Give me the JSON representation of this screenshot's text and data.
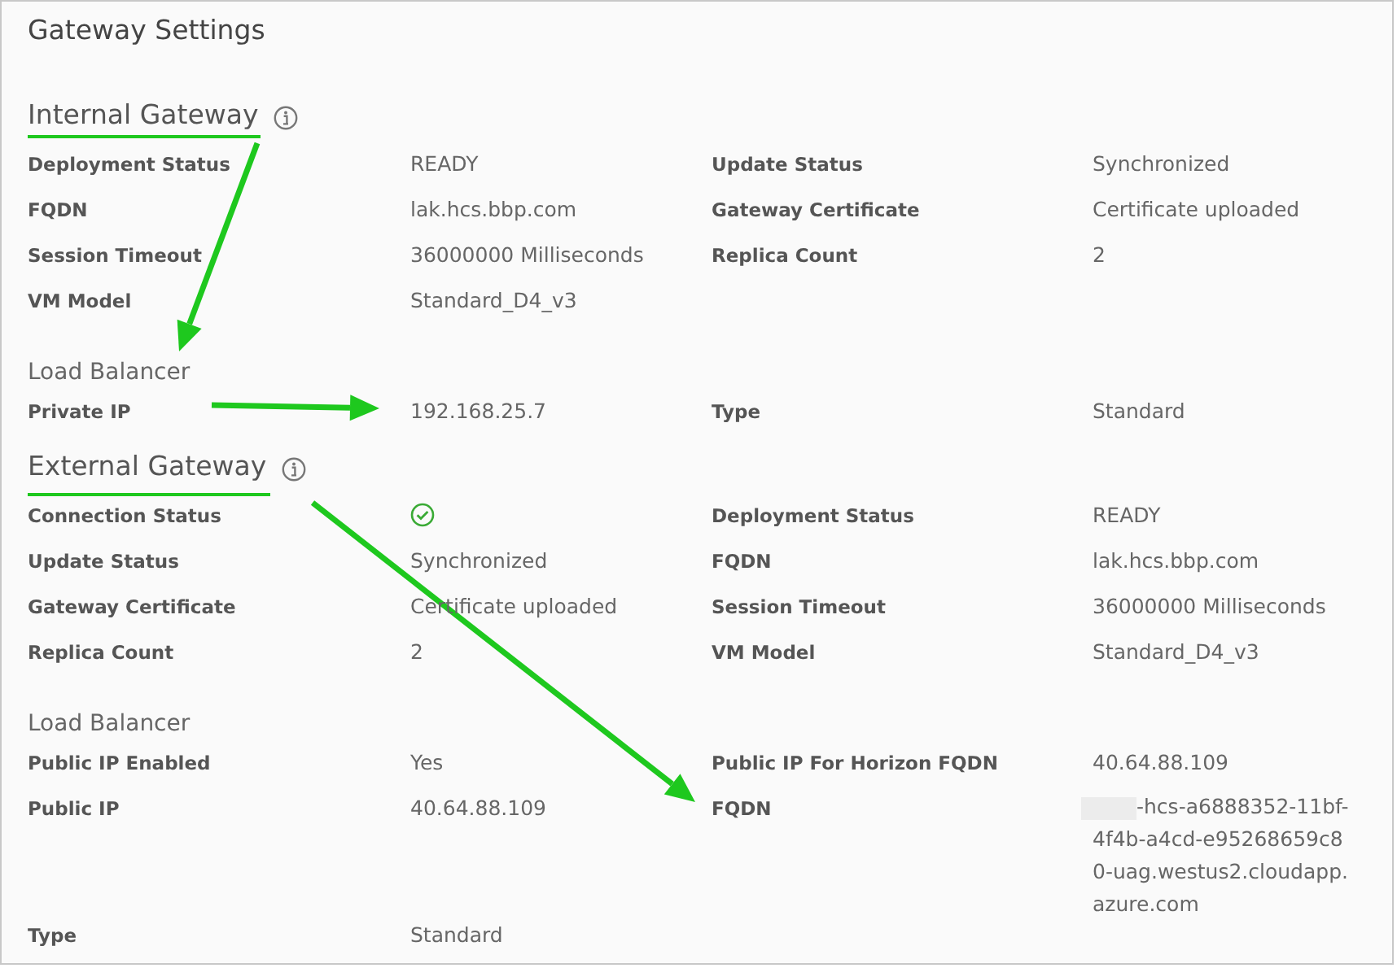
{
  "title": "Gateway Settings",
  "sections": [
    {
      "heading": "Internal Gateway",
      "fields": [
        {
          "kind": "text",
          "label": "Deployment Status",
          "value": "READY"
        },
        {
          "kind": "text",
          "label": "Update Status",
          "value": "Synchronized"
        },
        {
          "kind": "text",
          "label": "FQDN",
          "value": "lak.hcs.bbp.com"
        },
        {
          "kind": "text",
          "label": "Gateway Certificate",
          "value": "Certificate uploaded"
        },
        {
          "kind": "text",
          "label": "Session Timeout",
          "value": "36000000 Milliseconds"
        },
        {
          "kind": "text",
          "label": "Replica Count",
          "value": "2"
        },
        {
          "kind": "text",
          "label": "VM Model",
          "value": "Standard_D4_v3"
        }
      ],
      "load_balancer": {
        "heading": "Load Balancer",
        "fields": [
          {
            "kind": "text",
            "label": "Private IP",
            "value": "192.168.25.7"
          },
          {
            "kind": "text",
            "label": "Type",
            "value": "Standard"
          }
        ]
      }
    },
    {
      "heading": "External Gateway",
      "fields": [
        {
          "kind": "check",
          "label": "Connection Status"
        },
        {
          "kind": "text",
          "label": "Deployment Status",
          "value": "READY"
        },
        {
          "kind": "text",
          "label": "Update Status",
          "value": "Synchronized"
        },
        {
          "kind": "text",
          "label": "FQDN",
          "value": "lak.hcs.bbp.com"
        },
        {
          "kind": "text",
          "label": "Gateway Certificate",
          "value": "Certificate uploaded"
        },
        {
          "kind": "text",
          "label": "Session Timeout",
          "value": "36000000 Milliseconds"
        },
        {
          "kind": "text",
          "label": "Replica Count",
          "value": "2"
        },
        {
          "kind": "text",
          "label": "VM Model",
          "value": "Standard_D4_v3"
        }
      ],
      "load_balancer": {
        "heading": "Load Balancer",
        "fields": [
          {
            "kind": "text",
            "label": "Public IP Enabled",
            "value": "Yes"
          },
          {
            "kind": "text",
            "label": "Public IP For Horizon FQDN",
            "value": "40.64.88.109"
          },
          {
            "kind": "text",
            "label": "Public IP",
            "value": "40.64.88.109"
          },
          {
            "kind": "text",
            "label": "FQDN",
            "value": "-hcs-a6888352-11bf-4f4b-a4cd-e95268659c80-uag.westus2.cloudapp.azure.com",
            "redacted": true
          },
          {
            "kind": "text",
            "label": "Type",
            "value": "Standard"
          }
        ]
      }
    }
  ]
}
